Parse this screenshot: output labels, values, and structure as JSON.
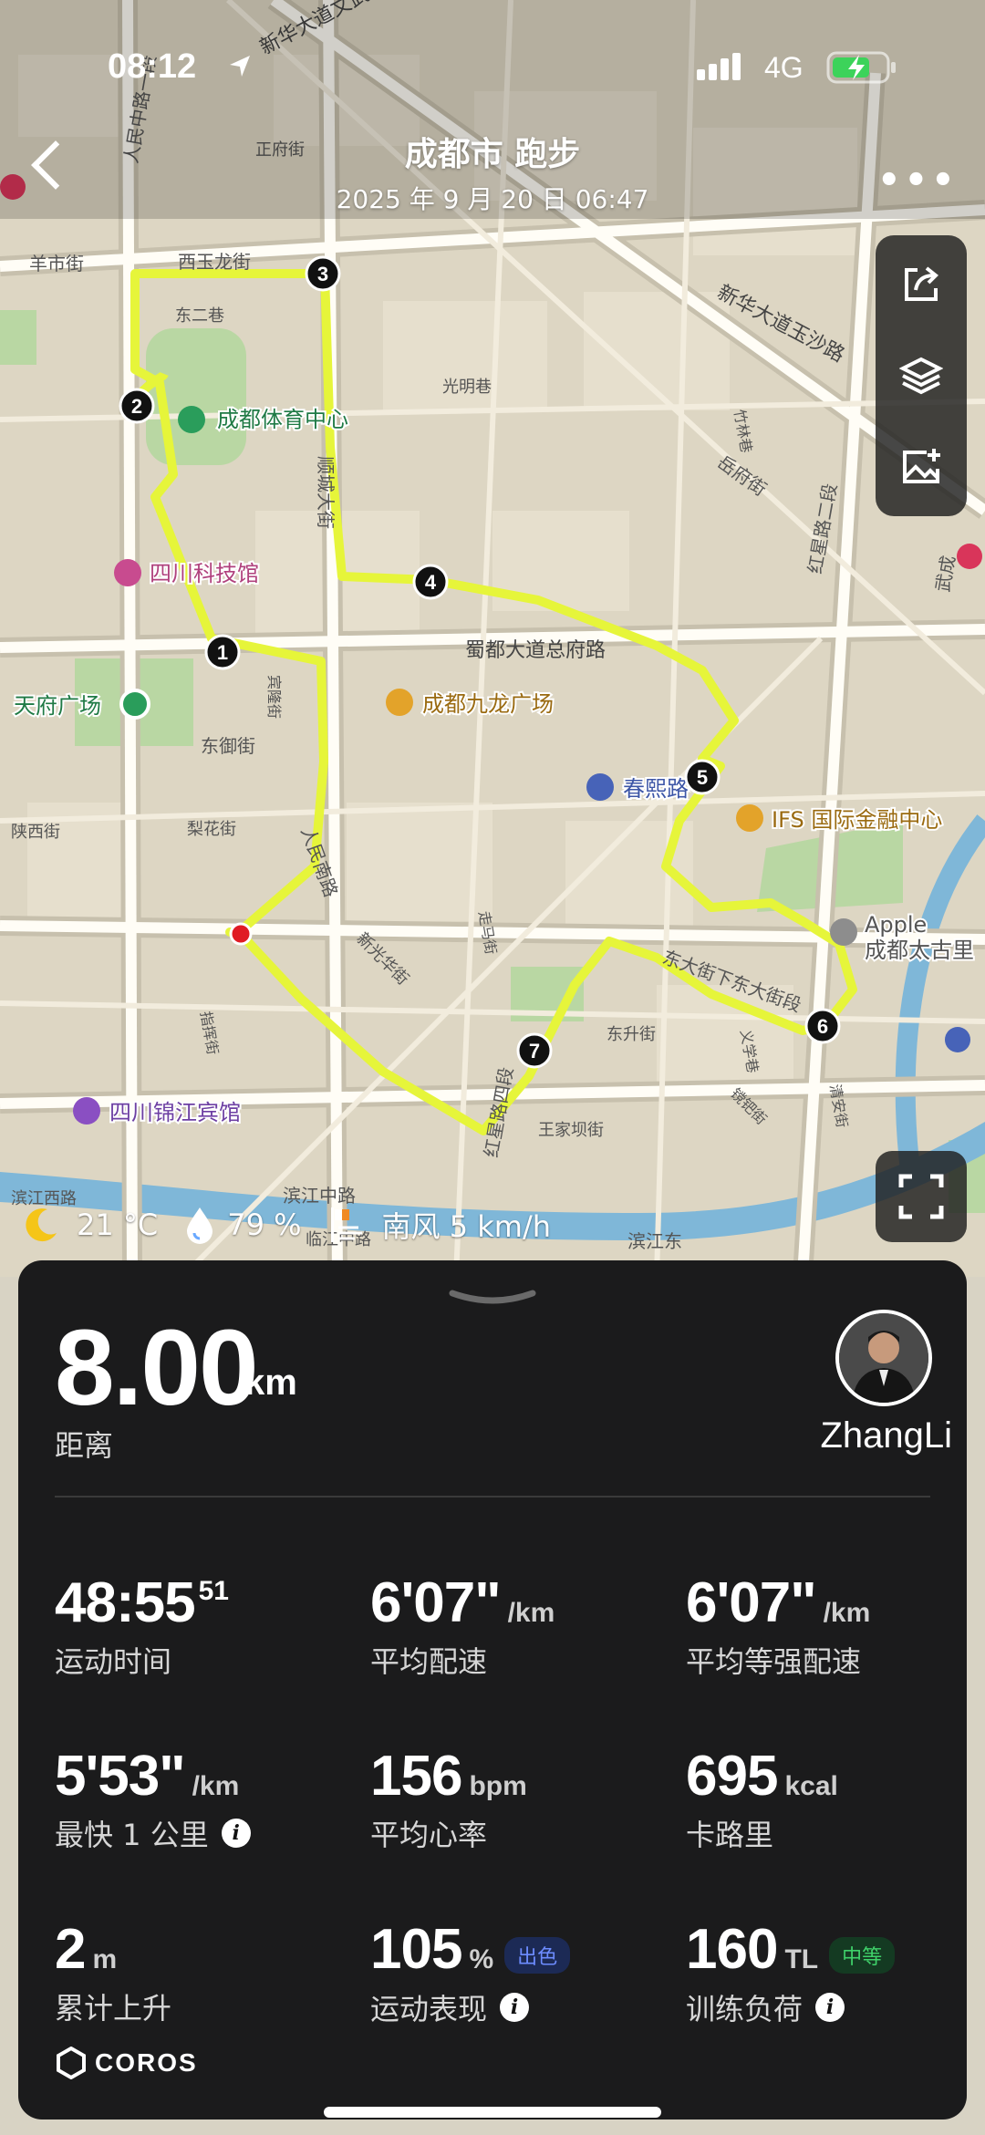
{
  "status_bar": {
    "time": "08:12",
    "network": "4G"
  },
  "header": {
    "title": "成都市 跑步",
    "datetime": "2025 年 9 月 20 日 06:47"
  },
  "map": {
    "labels": {
      "l1": "新华大道文武路",
      "l2": "正府街",
      "l3": "羊市街",
      "l4": "西玉龙街",
      "l5": "东二巷",
      "l6": "成都体育中心",
      "l7": "光明巷",
      "l8": "顺城大街",
      "l9": "四川科技馆",
      "l10": "蜀都大道总府路",
      "l11": "天府广场",
      "l12": "成都九龙广场",
      "l13": "东御街",
      "l14": "春熙路",
      "l15": "IFS 国际金融中心",
      "l16": "梨花街",
      "l17": "陕西街",
      "l18": "人民南路",
      "l19": "新华大道玉沙路",
      "l20": "岳府街",
      "l21": "红星路二段",
      "l22": "Apple",
      "l23": "成都太古里",
      "l24": "东大街下东大街段",
      "l25": "新光华街",
      "l26": "四川锦江宾馆",
      "l27": "滨江中路",
      "l28": "王家坝街",
      "l29": "红星路四段",
      "l30": "东升街",
      "l31": "走马街",
      "l32": "滨江西路",
      "l33": "宾隆街",
      "l34": "人民中路一段",
      "l35": "指挥街",
      "l36": "临江中路",
      "l37": "滨江东",
      "l38": "武成",
      "l39": "义学巷",
      "l40": "镋钯街",
      "l41": "清安街",
      "l42": "竹林巷"
    },
    "markers": [
      "1",
      "2",
      "3",
      "4",
      "5",
      "6",
      "7"
    ],
    "route_color": "#e6f53a"
  },
  "weather": {
    "temp": "21 °C",
    "humidity": "79 %",
    "wind": "南风 5 km/h"
  },
  "summary": {
    "distance": "8.00",
    "distance_unit": "km",
    "distance_label": "距离",
    "user": "ZhangLi"
  },
  "metrics": [
    {
      "value": "48:55",
      "sup": "51",
      "unit": "",
      "label": "运动时间"
    },
    {
      "value": "6'07\"",
      "unit": "/km",
      "label": "平均配速"
    },
    {
      "value": "6'07\"",
      "unit": "/km",
      "label": "平均等强配速"
    },
    {
      "value": "5'53\"",
      "unit": "/km",
      "label": "最快 1 公里"
    },
    {
      "value": "156",
      "unit": "bpm",
      "label": "平均心率"
    },
    {
      "value": "695",
      "unit": "kcal",
      "label": "卡路里"
    },
    {
      "value": "2",
      "unit": "m",
      "label": "累计上升"
    },
    {
      "value": "105",
      "unit": "%",
      "badge": "出色",
      "label": "运动表现"
    },
    {
      "value": "160",
      "unit": "TL",
      "badge": "中等",
      "label": "训练负荷"
    }
  ],
  "brand": "COROS",
  "colors": {
    "panel": "#1b1b1c",
    "route": "#e6f53a",
    "badge_blue": "#2f5fd0",
    "badge_green": "#1d7a3a"
  }
}
